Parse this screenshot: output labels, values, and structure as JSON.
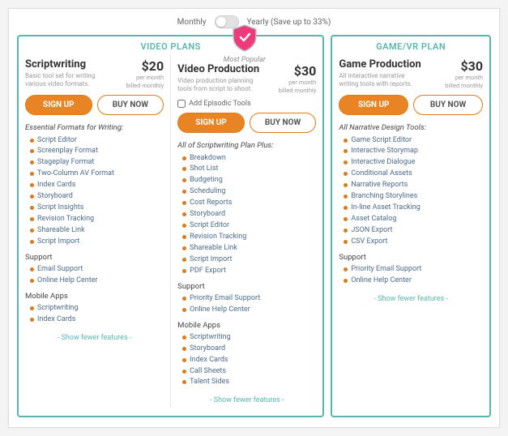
{
  "billing": {
    "monthly": "Monthly",
    "yearly": "Yearly (Save up to 33%)"
  },
  "groups": {
    "video_header": "VIDEO PLANS",
    "game_header": "GAME/VR PLAN"
  },
  "badge": {
    "label": "Most Popular"
  },
  "buttons": {
    "signup": "SIGN UP",
    "buynow": "BUY NOW",
    "show_fewer": "- Show fewer features -"
  },
  "plans": {
    "script": {
      "name": "Scriptwriting",
      "tag": "Basic tool set for writing various video formats.",
      "price": "$20",
      "per": "per month",
      "billed": "billed monthly",
      "heading": "Essential Formats for Writing:",
      "features": [
        "Script Editor",
        "Screenplay Format",
        "Stageplay Format",
        "Two-Column AV Format",
        "Index Cards",
        "Storyboard",
        "Script Insights",
        "Revision Tracking",
        "Shareable Link",
        "Script Import"
      ],
      "support_h": "Support",
      "support": [
        "Email Support",
        "Online Help Center"
      ],
      "mobile_h": "Mobile Apps",
      "mobile": [
        "Scriptwriting",
        "Index Cards"
      ]
    },
    "vp": {
      "name": "Video Production",
      "tag": "Video production planning tools from script to shoot.",
      "price": "$30",
      "per": "per month",
      "billed": "billed monthly",
      "addon": "Add Episodic Tools",
      "heading": "All of Scriptwriting Plan Plus:",
      "features": [
        "Breakdown",
        "Shot List",
        "Budgeting",
        "Scheduling",
        "Cost Reports",
        "Storyboard",
        "Script Editor",
        "Revision Tracking",
        "Shareable Link",
        "Script Import",
        "PDF Export"
      ],
      "support_h": "Support",
      "support": [
        "Priority Email Support",
        "Online Help Center"
      ],
      "mobile_h": "Mobile Apps",
      "mobile": [
        "Scriptwriting",
        "Storyboard",
        "Index Cards",
        "Call Sheets",
        "Talent Sides"
      ]
    },
    "game": {
      "name": "Game Production",
      "tag": "All interactive narrative writing tools with reports.",
      "price": "$30",
      "per": "per month",
      "billed": "billed monthly",
      "heading": "All Narrative Design Tools:",
      "features": [
        "Game Script Editor",
        "Interactive Storymap",
        "Interactive Dialogue",
        "Conditional Assets",
        "Narrative Reports",
        "Branching Storylines",
        "In-line Asset Tracking",
        "Asset Catalog",
        "JSON Export",
        "CSV Export"
      ],
      "support_h": "Support",
      "support": [
        "Priority Email Support",
        "Online Help Center"
      ]
    }
  }
}
